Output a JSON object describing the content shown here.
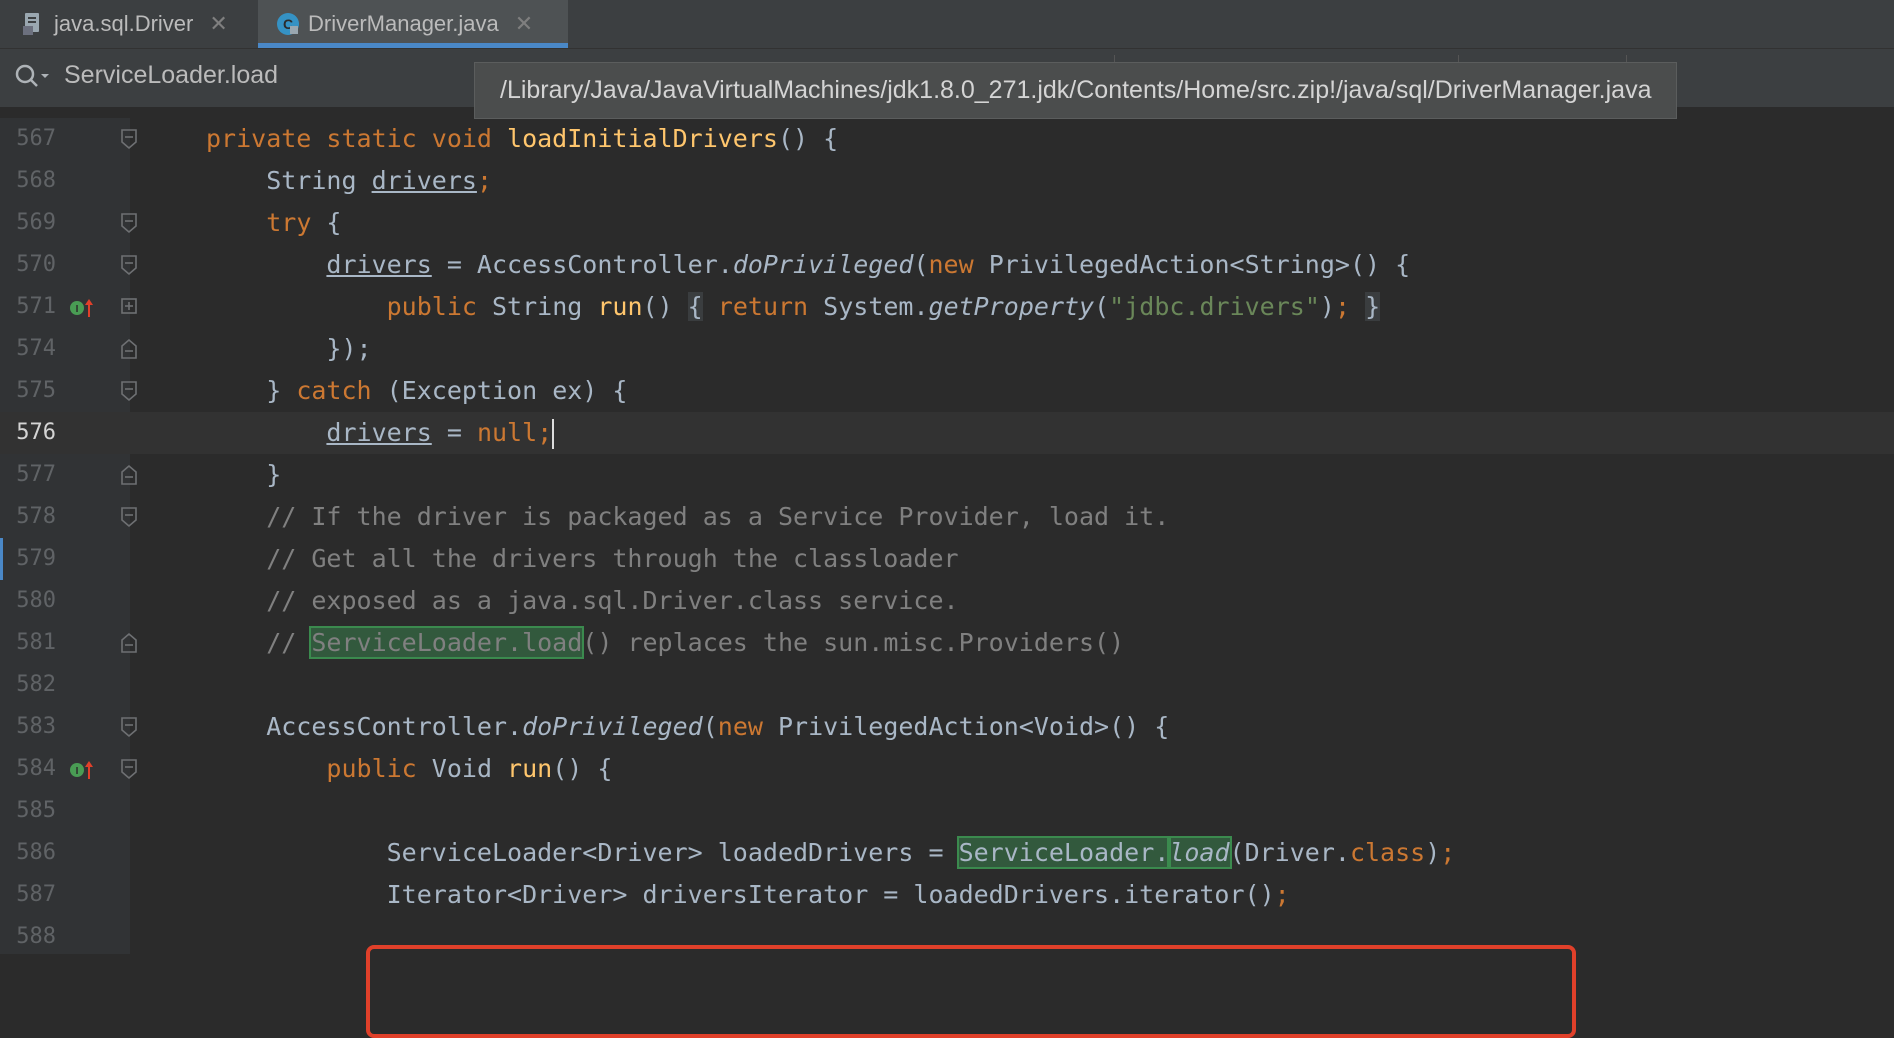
{
  "tabs": [
    {
      "label": "java.sql.Driver",
      "icon": "class-file-icon",
      "active": false
    },
    {
      "label": "DriverManager.java",
      "icon": "java-class-icon",
      "active": true
    }
  ],
  "search": {
    "value": "ServiceLoader.load"
  },
  "tooltip": {
    "path": "/Library/Java/JavaVirtualMachines/jdk1.8.0_271.jdk/Contents/Home/src.zip!/java/sql/DriverManager.java"
  },
  "colors": {
    "keyword": "#cc7832",
    "method": "#ffc66d",
    "string": "#6a8759",
    "comment": "#808080",
    "highlight_box": "#e0402a",
    "match": "#32593d"
  },
  "lines": [
    {
      "num": "567",
      "segs": [
        [
          "private static void ",
          "kw"
        ],
        [
          "loadInitialDrivers",
          "fn"
        ],
        [
          "() {",
          ""
        ]
      ]
    },
    {
      "num": "568",
      "segs": [
        [
          "    String ",
          ""
        ],
        [
          "drivers",
          "ul"
        ],
        [
          ";",
          "kw"
        ]
      ]
    },
    {
      "num": "569",
      "segs": [
        [
          "    ",
          ""
        ],
        [
          "try",
          "kw"
        ],
        [
          " {",
          ""
        ]
      ]
    },
    {
      "num": "570",
      "segs": [
        [
          "        ",
          ""
        ],
        [
          "drivers",
          "ul"
        ],
        [
          " = AccessController.",
          ""
        ],
        [
          "doPrivileged",
          "it"
        ],
        [
          "(",
          ""
        ],
        [
          "new",
          "kw"
        ],
        [
          " PrivilegedAction<String>() {",
          ""
        ]
      ]
    },
    {
      "num": "571",
      "segs": [
        [
          "            ",
          ""
        ],
        [
          "public",
          "kw"
        ],
        [
          " String ",
          ""
        ],
        [
          "run",
          "fn"
        ],
        [
          "() ",
          ""
        ],
        [
          "{",
          "fb"
        ],
        [
          " ",
          ""
        ],
        [
          "return",
          "kw"
        ],
        [
          " System.",
          ""
        ],
        [
          "getProperty",
          "it"
        ],
        [
          "(",
          ""
        ],
        [
          "\"jdbc.drivers\"",
          "str"
        ],
        [
          ")",
          ""
        ],
        [
          ";",
          "kw"
        ],
        [
          " ",
          ""
        ],
        [
          "}",
          "fb"
        ]
      ]
    },
    {
      "num": "574",
      "segs": [
        [
          "        });",
          ""
        ]
      ]
    },
    {
      "num": "575",
      "segs": [
        [
          "    } ",
          ""
        ],
        [
          "catch",
          "kw"
        ],
        [
          " (Exception ex) {",
          ""
        ]
      ]
    },
    {
      "num": "576",
      "segs": [
        [
          "        ",
          ""
        ],
        [
          "drivers",
          "ul"
        ],
        [
          " = ",
          ""
        ],
        [
          "null",
          "kw"
        ],
        [
          ";",
          "kw"
        ],
        [
          "",
          "caret"
        ]
      ]
    },
    {
      "num": "577",
      "segs": [
        [
          "    }",
          ""
        ]
      ]
    },
    {
      "num": "578",
      "segs": [
        [
          "    // If the driver is packaged as a Service Provider, load it.",
          "cmt"
        ]
      ]
    },
    {
      "num": "579",
      "segs": [
        [
          "    // Get all the drivers through the classloader",
          "cmt"
        ]
      ]
    },
    {
      "num": "580",
      "segs": [
        [
          "    // exposed as a java.sql.Driver.class service.",
          "cmt"
        ]
      ]
    },
    {
      "num": "581",
      "segs": [
        [
          "    // ",
          "cmt"
        ],
        [
          "ServiceLoader.load",
          "hl cmt"
        ],
        [
          "() replaces the sun.misc.Providers()",
          "cmt"
        ]
      ]
    },
    {
      "num": "582",
      "segs": []
    },
    {
      "num": "583",
      "segs": [
        [
          "    AccessController.",
          ""
        ],
        [
          "doPrivileged",
          "it"
        ],
        [
          "(",
          ""
        ],
        [
          "new",
          "kw"
        ],
        [
          " PrivilegedAction<Void>() {",
          ""
        ]
      ]
    },
    {
      "num": "584",
      "segs": [
        [
          "        ",
          ""
        ],
        [
          "public",
          "kw"
        ],
        [
          " Void ",
          ""
        ],
        [
          "run",
          "fn"
        ],
        [
          "() {",
          ""
        ]
      ]
    },
    {
      "num": "585",
      "segs": []
    },
    {
      "num": "586",
      "segs": [
        [
          "            ServiceLoader<Driver> loadedDrivers = ",
          ""
        ],
        [
          "ServiceLoader.",
          "hl"
        ],
        [
          "load",
          "hl it"
        ],
        [
          "(Driver.",
          ""
        ],
        [
          "class",
          "kw"
        ],
        [
          ")",
          ""
        ],
        [
          ";",
          "kw"
        ]
      ]
    },
    {
      "num": "587",
      "segs": [
        [
          "            Iterator<Driver> driversIterator = loadedDrivers.iterator()",
          ""
        ],
        [
          ";",
          "kw"
        ]
      ]
    },
    {
      "num": "588",
      "segs": []
    }
  ]
}
